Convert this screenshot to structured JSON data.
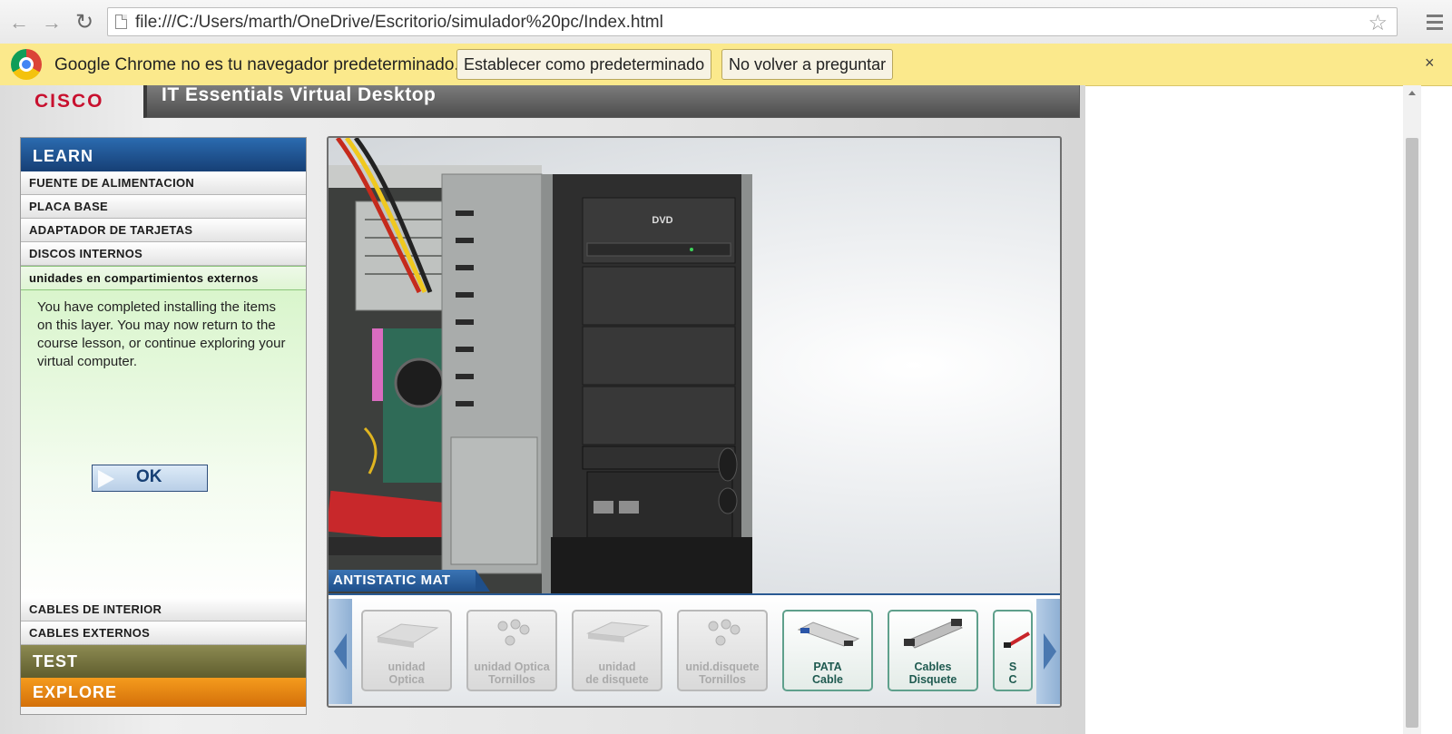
{
  "browser": {
    "url": "file:///C:/Users/marth/OneDrive/Escritorio/simulador%20pc/Index.html",
    "back_icon": "back-arrow-icon",
    "forward_icon": "forward-arrow-icon",
    "reload_icon": "reload-icon",
    "star_icon": "bookmark-star-icon",
    "menu_icon": "hamburger-menu-icon"
  },
  "infobar": {
    "message": "Google Chrome no es tu navegador predeterminado.",
    "set_default": "Establecer como predeterminado",
    "dont_ask": "No volver a preguntar",
    "close": "×"
  },
  "app": {
    "logo": "CISCO",
    "title": "IT Essentials Virtual Desktop",
    "learn": "LEARN",
    "menu": [
      "FUENTE DE ALIMENTACION",
      "PLACA BASE",
      "ADAPTADOR DE TARJETAS",
      "DISCOS INTERNOS",
      "unidades en compartimientos externos"
    ],
    "message": "You have completed installing the items on this layer. You may now return to the course lesson, or continue exploring your virtual computer.",
    "ok": "OK",
    "menu_bottom": [
      "CABLES DE INTERIOR",
      "CABLES EXTERNOS"
    ],
    "test": "TEST",
    "explore": "EXPLORE",
    "mat_label": "ANTISTATIC MAT",
    "dvd_label": "DVD",
    "tiles": [
      {
        "line1": "unidad",
        "line2": "Optica",
        "active": false
      },
      {
        "line1": "unidad Optica",
        "line2": "Tornillos",
        "active": false
      },
      {
        "line1": "unidad",
        "line2": "de disquete",
        "active": false
      },
      {
        "line1": "unid.disquete",
        "line2": "Tornillos",
        "active": false
      },
      {
        "line1": "PATA",
        "line2": "Cable",
        "active": true
      },
      {
        "line1": "Cables",
        "line2": "Disquete",
        "active": true
      },
      {
        "line1": "S",
        "line2": "C",
        "active": true
      }
    ]
  },
  "colors": {
    "learn_blue": "#1f4f8a",
    "test_olive": "#7a7842",
    "explore_orange": "#e8870f",
    "infobar_yellow": "#fbe98c",
    "cisco_red": "#c8102e"
  }
}
